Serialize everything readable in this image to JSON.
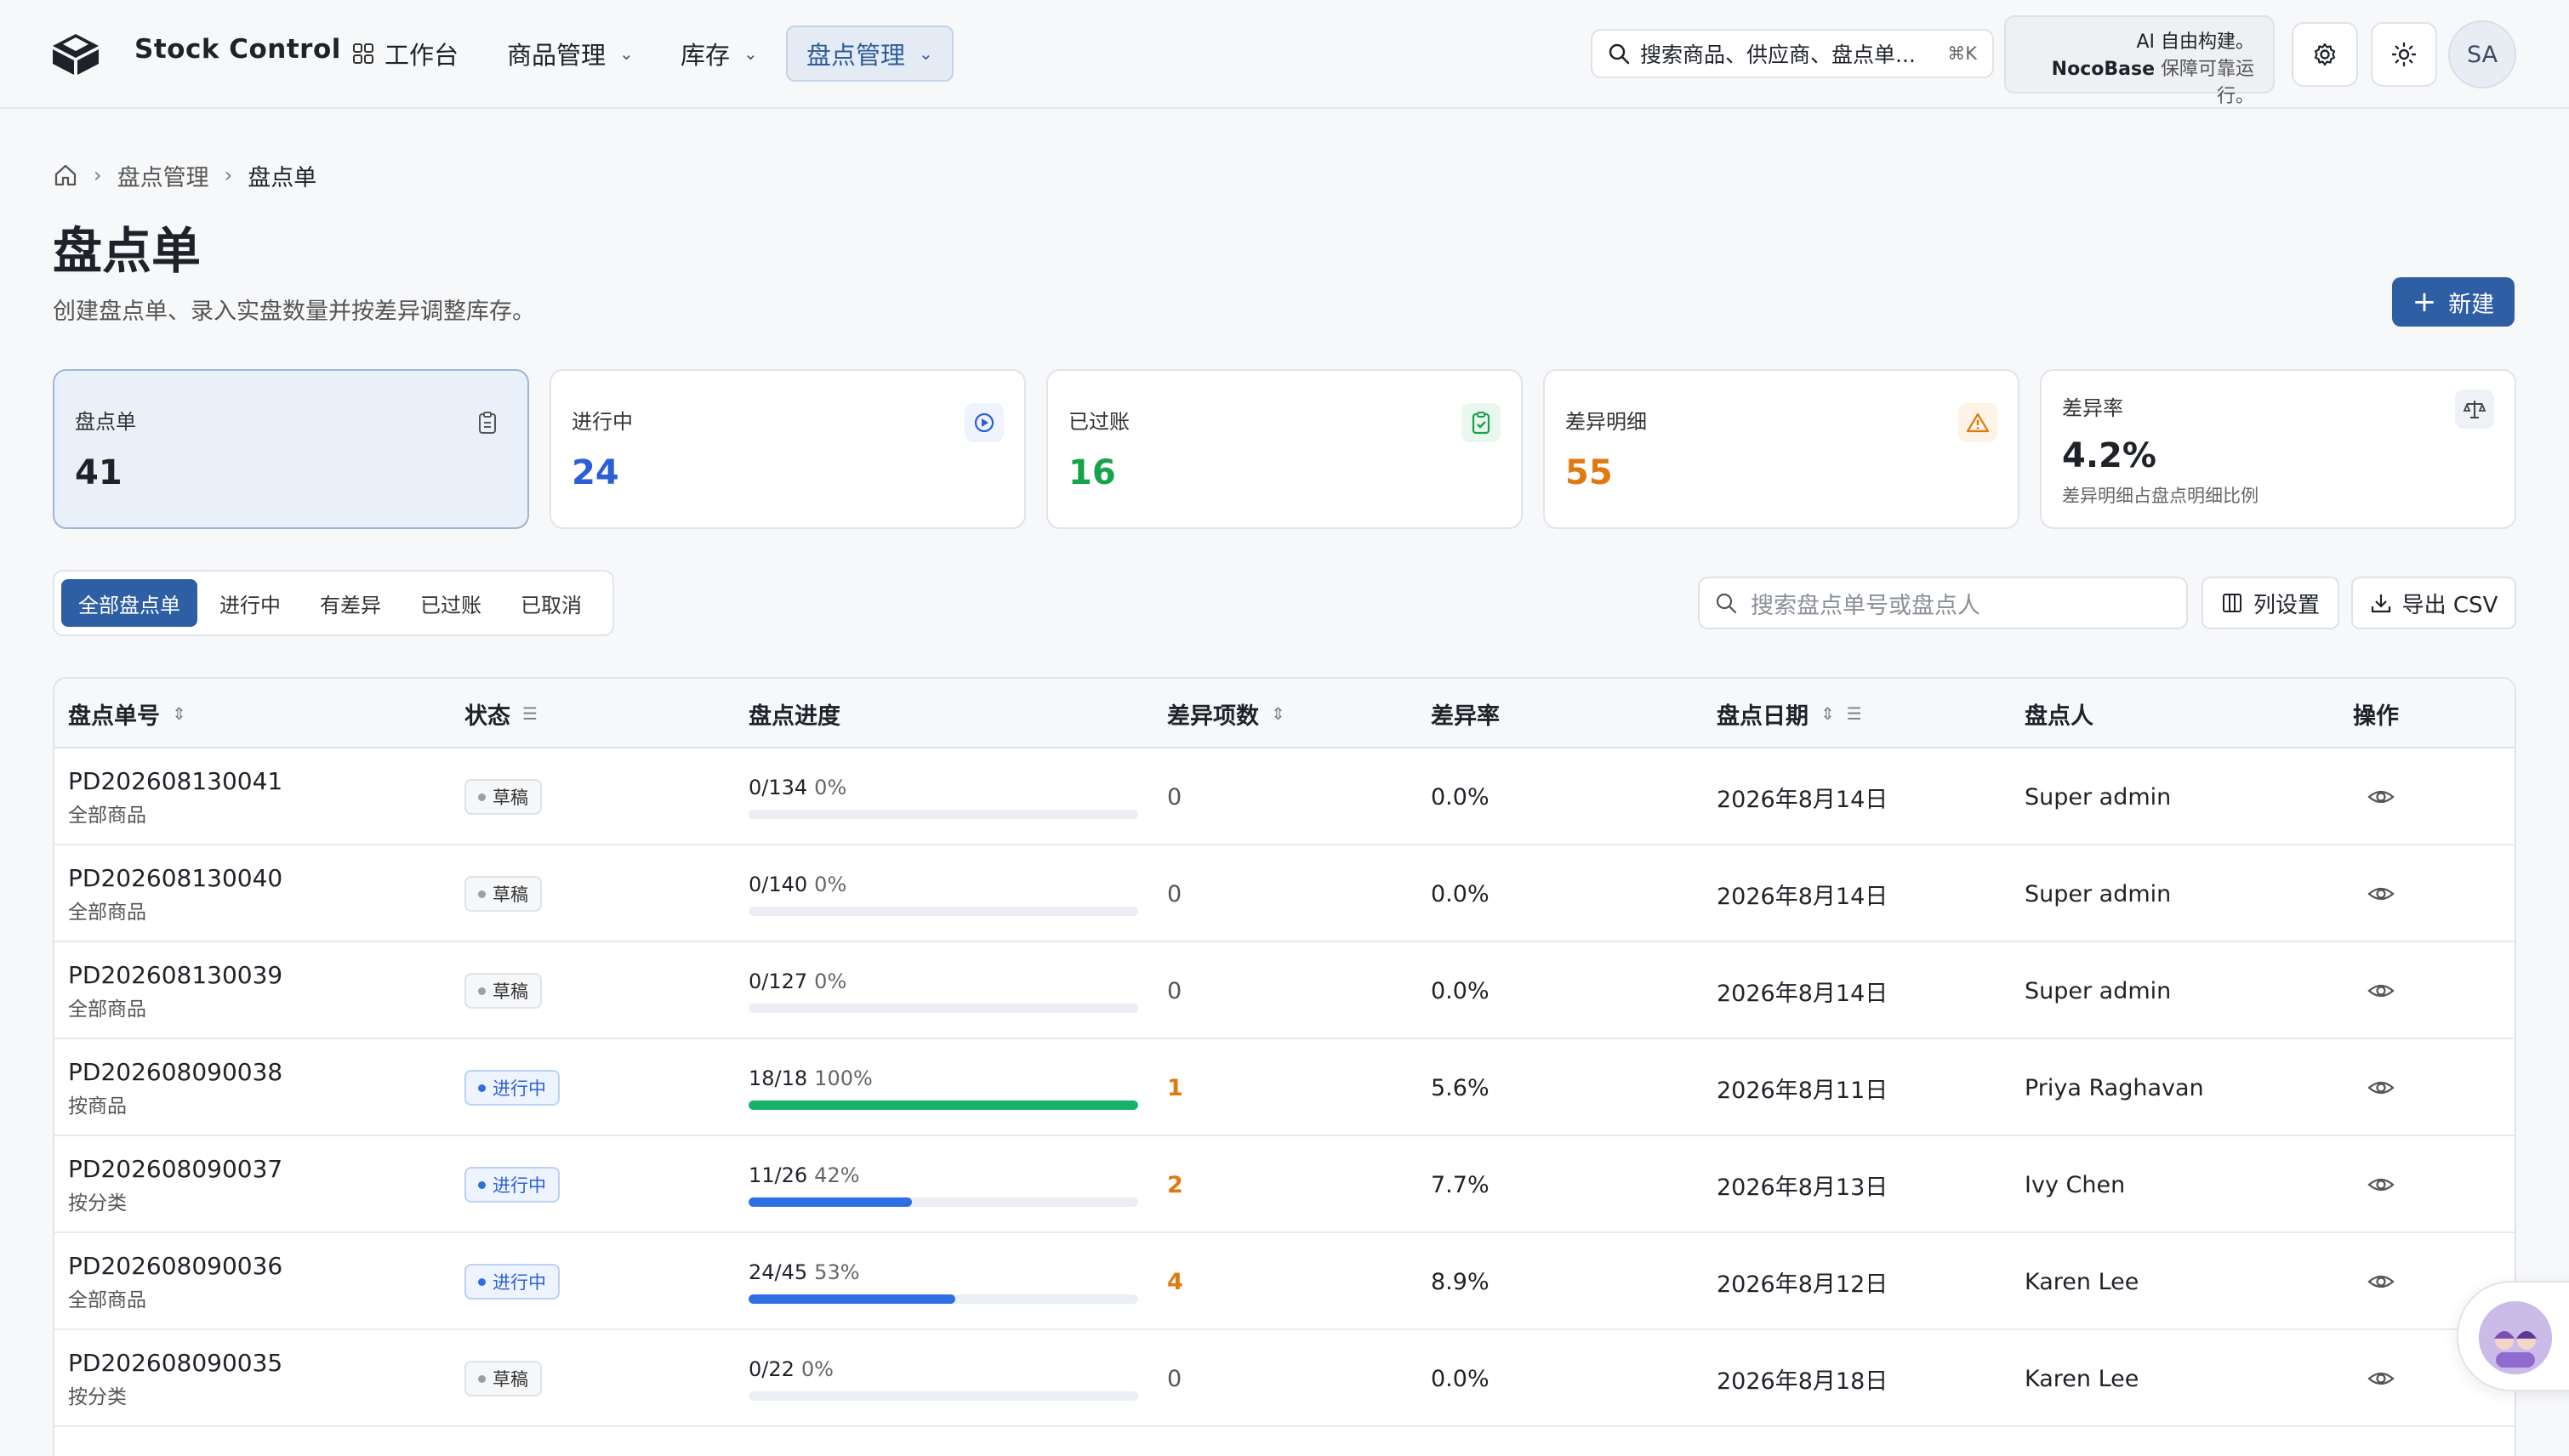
{
  "app": {
    "title": "Stock Control"
  },
  "nav": {
    "workbench": "工作台",
    "products": "商品管理",
    "inventory": "库存",
    "stocktake": "盘点管理"
  },
  "search": {
    "placeholder": "搜索商品、供应商、盘点单...",
    "shortcut": "⌘K"
  },
  "promo": {
    "line1": "AI 自由构建。",
    "line2_brand": "NocoBase",
    "line2_rest": "保障可靠运行。"
  },
  "user": {
    "initials": "SA"
  },
  "breadcrumb": {
    "parent": "盘点管理",
    "current": "盘点单"
  },
  "page": {
    "title": "盘点单",
    "description": "创建盘点单、录入实盘数量并按差异调整库存。",
    "new_button": "新建"
  },
  "stats": [
    {
      "label": "盘点单",
      "value": "41",
      "color": "#1f2329"
    },
    {
      "label": "进行中",
      "value": "24",
      "color": "#2b5fd9"
    },
    {
      "label": "已过账",
      "value": "16",
      "color": "#16a34a"
    },
    {
      "label": "差异明细",
      "value": "55",
      "color": "#e07a10"
    },
    {
      "label": "差异率",
      "value": "4.2%",
      "sub": "差异明细占盘点明细比例",
      "color": "#1f2329"
    }
  ],
  "filters": {
    "tabs": [
      "全部盘点单",
      "进行中",
      "有差异",
      "已过账",
      "已取消"
    ],
    "active_index": 0,
    "search_placeholder": "搜索盘点单号或盘点人",
    "columns_button": "列设置",
    "export_button": "导出 CSV"
  },
  "table": {
    "headers": {
      "id": "盘点单号",
      "status": "状态",
      "progress": "盘点进度",
      "diff_count": "差异项数",
      "diff_rate": "差异率",
      "date": "盘点日期",
      "counter": "盘点人",
      "actions": "操作"
    },
    "rows": [
      {
        "id": "PD202608130041",
        "scope": "全部商品",
        "status": "草稿",
        "status_kind": "draft",
        "progress_text": "0/134",
        "progress_pct": "0%",
        "progress": 0,
        "diff_count": "0",
        "diff_rate": "0.0%",
        "date": "2026年8月14日",
        "counter": "Super admin"
      },
      {
        "id": "PD202608130040",
        "scope": "全部商品",
        "status": "草稿",
        "status_kind": "draft",
        "progress_text": "0/140",
        "progress_pct": "0%",
        "progress": 0,
        "diff_count": "0",
        "diff_rate": "0.0%",
        "date": "2026年8月14日",
        "counter": "Super admin"
      },
      {
        "id": "PD202608130039",
        "scope": "全部商品",
        "status": "草稿",
        "status_kind": "draft",
        "progress_text": "0/127",
        "progress_pct": "0%",
        "progress": 0,
        "diff_count": "0",
        "diff_rate": "0.0%",
        "date": "2026年8月14日",
        "counter": "Super admin"
      },
      {
        "id": "PD202608090038",
        "scope": "按商品",
        "status": "进行中",
        "status_kind": "progress",
        "progress_text": "18/18",
        "progress_pct": "100%",
        "progress": 1.0,
        "diff_count": "1",
        "diff_rate": "5.6%",
        "date": "2026年8月11日",
        "counter": "Priya Raghavan"
      },
      {
        "id": "PD202608090037",
        "scope": "按分类",
        "status": "进行中",
        "status_kind": "progress",
        "progress_text": "11/26",
        "progress_pct": "42%",
        "progress": 0.42,
        "diff_count": "2",
        "diff_rate": "7.7%",
        "date": "2026年8月13日",
        "counter": "Ivy Chen"
      },
      {
        "id": "PD202608090036",
        "scope": "全部商品",
        "status": "进行中",
        "status_kind": "progress",
        "progress_text": "24/45",
        "progress_pct": "53%",
        "progress": 0.53,
        "diff_count": "4",
        "diff_rate": "8.9%",
        "date": "2026年8月12日",
        "counter": "Karen Lee"
      },
      {
        "id": "PD202608090035",
        "scope": "按分类",
        "status": "草稿",
        "status_kind": "draft",
        "progress_text": "0/22",
        "progress_pct": "0%",
        "progress": 0,
        "diff_count": "0",
        "diff_rate": "0.0%",
        "date": "2026年8月18日",
        "counter": "Karen Lee"
      }
    ]
  },
  "colors": {
    "accent": "#2e5ea3",
    "progress_full": "#16b26a",
    "progress_partial": "#2f6fe4",
    "diff_positive": "#e07a10"
  }
}
